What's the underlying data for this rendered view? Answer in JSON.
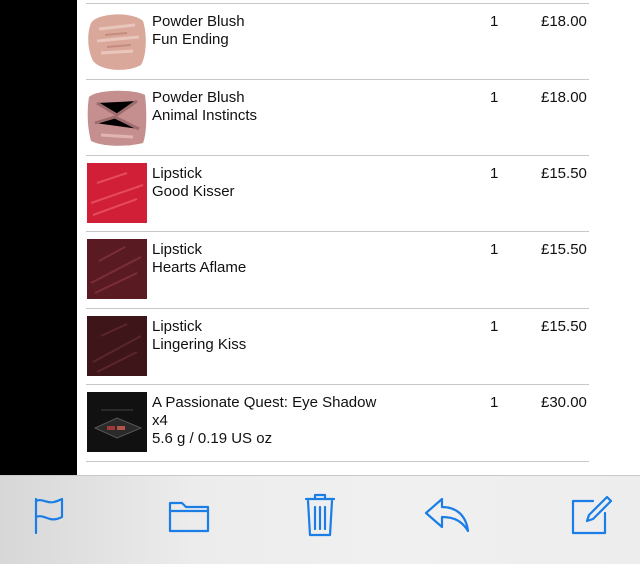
{
  "order": {
    "items": [
      {
        "line1": "Powder Blush",
        "line2": "Fun Ending",
        "line3": "",
        "qty": "1",
        "price": "£18.00"
      },
      {
        "line1": "Powder Blush",
        "line2": "Animal Instincts",
        "line3": "",
        "qty": "1",
        "price": "£18.00"
      },
      {
        "line1": "Lipstick",
        "line2": "Good Kisser",
        "line3": "",
        "qty": "1",
        "price": "£15.50"
      },
      {
        "line1": "Lipstick",
        "line2": "Hearts Aflame",
        "line3": "",
        "qty": "1",
        "price": "£15.50"
      },
      {
        "line1": "Lipstick",
        "line2": "Lingering Kiss",
        "line3": "",
        "qty": "1",
        "price": "£15.50"
      },
      {
        "line1": "A Passionate Quest: Eye Shadow",
        "line2": "x4",
        "line3": "5.6 g / 0.19 US oz",
        "qty": "1",
        "price": "£30.00"
      }
    ],
    "swatch_colors": [
      "#d9a89a",
      "#c68f8f",
      "#d11f37",
      "#5a1a22",
      "#3e1519",
      "#111111"
    ]
  },
  "toolbar": {
    "buttons": [
      "flag-icon",
      "folder-icon",
      "trash-icon",
      "reply-icon",
      "compose-icon"
    ],
    "icon_color": "#1a7ee6"
  }
}
